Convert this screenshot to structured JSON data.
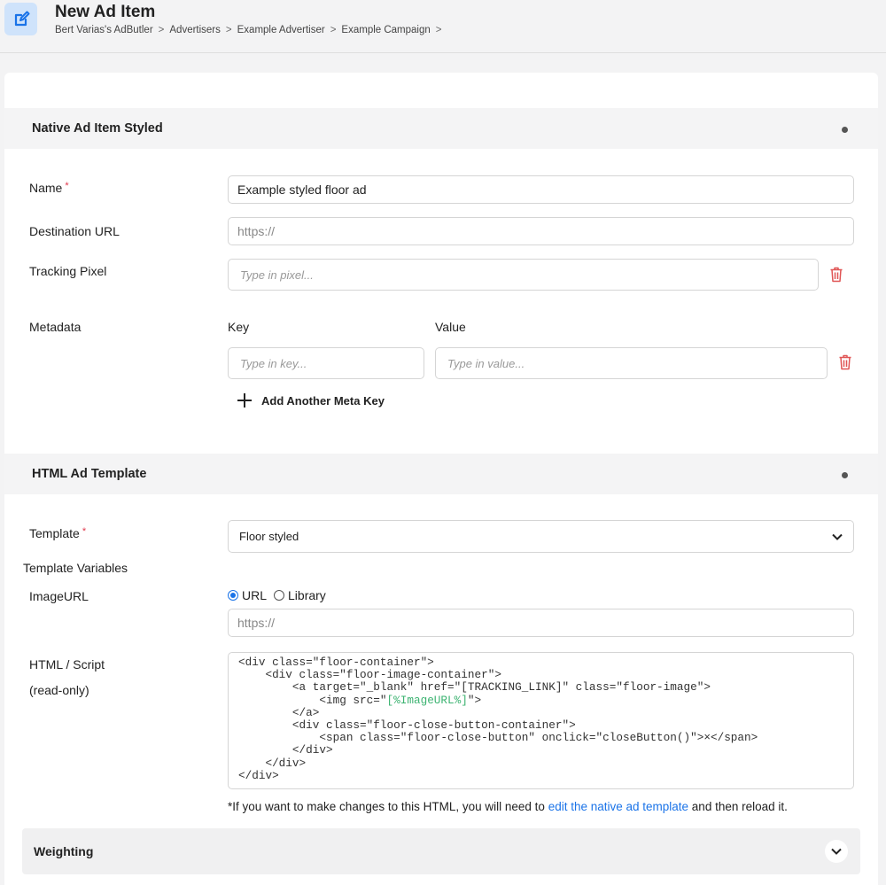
{
  "header": {
    "title": "New Ad Item",
    "breadcrumb": [
      "Bert Varias's AdButler",
      "Advertisers",
      "Example Advertiser",
      "Example Campaign"
    ],
    "separator": ">"
  },
  "native_section": {
    "title": "Native Ad Item Styled",
    "name_label": "Name",
    "required_mark": "*",
    "name_value": "Example styled floor ad",
    "destination_label": "Destination URL",
    "destination_placeholder": "https://",
    "tracking_label": "Tracking Pixel",
    "tracking_placeholder": "Type in pixel...",
    "metadata_label": "Metadata",
    "key_header": "Key",
    "value_header": "Value",
    "key_placeholder": "Type in key...",
    "value_placeholder": "Type in value...",
    "add_meta_label": "Add Another Meta Key"
  },
  "template_section": {
    "title": "HTML Ad Template",
    "template_label": "Template",
    "required_mark": "*",
    "template_value": "Floor styled",
    "variables_label": "Template Variables",
    "image_url_label": "ImageURL",
    "radio_url": "URL",
    "radio_library": "Library",
    "radio_selected": "URL",
    "image_url_placeholder": "https://",
    "html_label": "HTML / Script",
    "readonly_label": "(read-only)",
    "code_lines": [
      "<div class=\"floor-container\">",
      "    <div class=\"floor-image-container\">",
      "        <a target=\"_blank\" href=\"[TRACKING_LINK]\" class=\"floor-image\">",
      "            <img src=\"",
      "[%ImageURL%]",
      "\">",
      "        </a>",
      "        <div class=\"floor-close-button-container\">",
      "            <span class=\"floor-close-button\" onclick=\"closeButton()\">×</span>",
      "        </div>",
      "    </div>",
      "</div>"
    ],
    "note_before": "*If you want to make changes to this HTML, you will need to ",
    "note_link": "edit the native ad template",
    "note_after": " and then reload it."
  },
  "weighting": {
    "title": "Weighting"
  },
  "colors": {
    "accent": "#1a73e8",
    "danger": "#e05555",
    "template_var": "#3cb371"
  },
  "icons": {
    "page": "edit-square-icon",
    "delete": "trash-icon",
    "add": "plus-icon",
    "dropdown": "chevron-down-icon",
    "collapse": "dot-icon"
  }
}
